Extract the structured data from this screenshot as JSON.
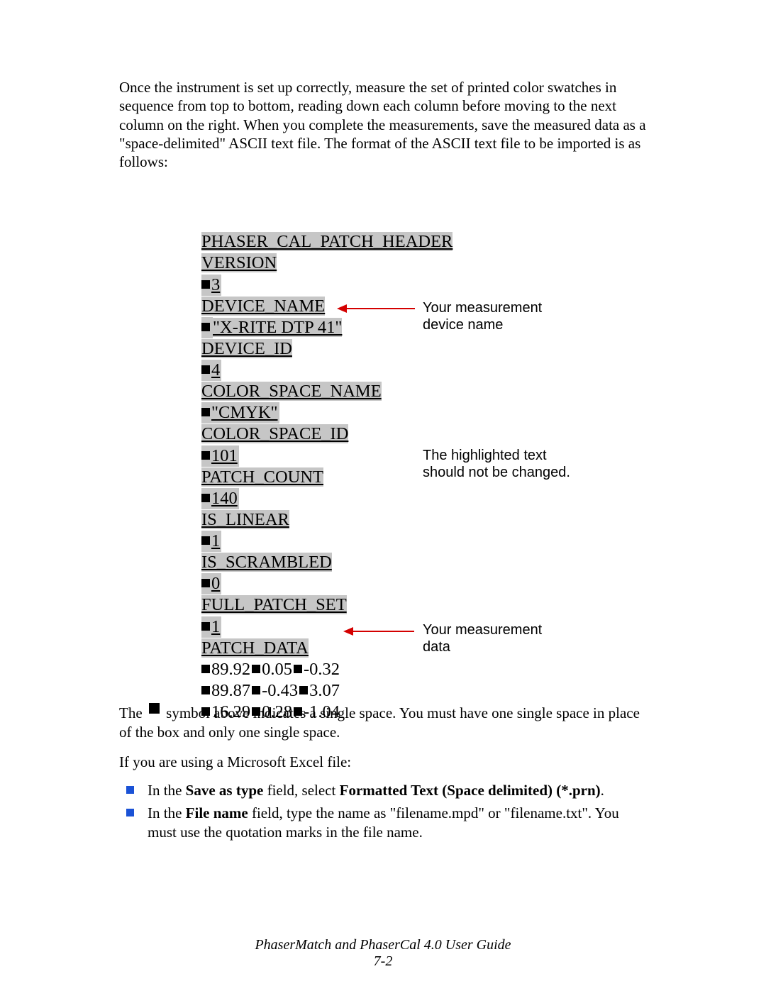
{
  "intro": "Once the instrument is set up correctly, measure the set of printed color swatches in sequence from top to bottom, reading down each column before moving to the next column on the right. When you complete the measurements, save the measured data as a \"space-delimited\" ASCII text file. The format of the ASCII text file to be imported is as follows:",
  "code": {
    "l1": "PHASER_CAL_PATCH_HEADER",
    "l2": "VERSION",
    "l3": "3",
    "l4": "DEVICE_NAME",
    "l5": "\"X-RITE DTP 41\"",
    "l6": "DEVICE_ID",
    "l7": "4",
    "l8": "COLOR_SPACE_NAME",
    "l9": "\"CMYK\"",
    "l10": "COLOR_SPACE_ID",
    "l11": "101",
    "l12": "PATCH_COUNT",
    "l13": "140",
    "l14": "IS_LINEAR",
    "l15": "1",
    "l16": "IS_SCRAMBLED",
    "l17": "0",
    "l18": "FULL_PATCH_SET",
    "l19": "1",
    "l20": "PATCH_DATA",
    "d1a": "89.92",
    "d1b": "0.05",
    "d1c": "-0.32",
    "d2a": "89.87",
    "d2b": "-0.43",
    "d2c": "3.07",
    "d3a": "16.29",
    "d3b": "0.28",
    "d3c": "-1.04"
  },
  "annot": {
    "a1": "Your measurement device name",
    "a2": "The highlighted text should not be changed.",
    "a3": "Your measurement data"
  },
  "note_pre": "The ",
  "note_post": " symbol above indicates a single space. You must have one single space in place of the box and only one single space.",
  "excel_intro": "If you are using a Microsoft Excel file:",
  "bullet1_pre": "In the ",
  "bullet1_b1": "Save as type",
  "bullet1_mid": " field, select ",
  "bullet1_b2": "Formatted Text (Space delimited) (*.prn)",
  "bullet1_post": ".",
  "bullet2_pre": "In the ",
  "bullet2_b1": "File name",
  "bullet2_post": " field, type the name as \"filename.mpd\" or \"filename.txt\". You must use the quotation marks in the file name.",
  "footer_title": "PhaserMatch and PhaserCal 4.0 User Guide",
  "footer_page": "7-2"
}
